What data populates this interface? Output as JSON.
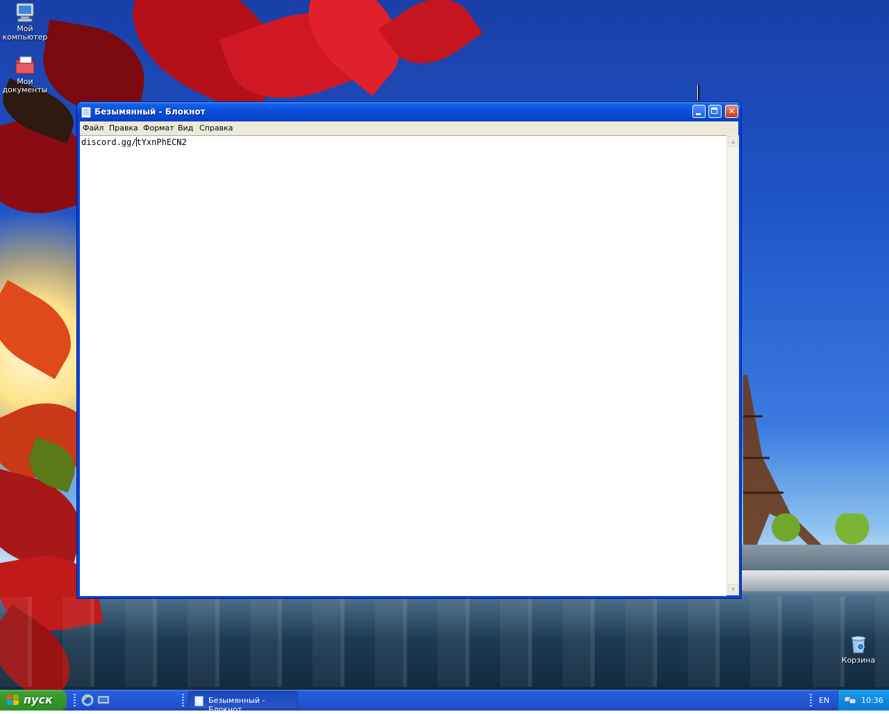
{
  "desktop": {
    "icons": [
      {
        "label": "Мой компьютер",
        "icon": "my-computer-icon"
      },
      {
        "label": "Мои документы",
        "icon": "my-documents-icon"
      },
      {
        "label": "Корзина",
        "icon": "recycle-bin-icon"
      }
    ]
  },
  "window": {
    "title": "Безымянный - Блокнот",
    "menu": [
      "Файл",
      "Правка",
      "Формат",
      "Вид",
      "Справка"
    ],
    "content_before_caret": "discord.gg/",
    "content_after_caret": "tYxnPhECN2"
  },
  "taskbar": {
    "start_label": "пуск",
    "task_button_label": "Безымянный - Блокнот",
    "language": "EN",
    "clock": "10:36"
  },
  "colors": {
    "titlebar": "#0a50de",
    "taskbar": "#245edb",
    "start": "#3e9c33",
    "tray": "#0e8ae0"
  }
}
